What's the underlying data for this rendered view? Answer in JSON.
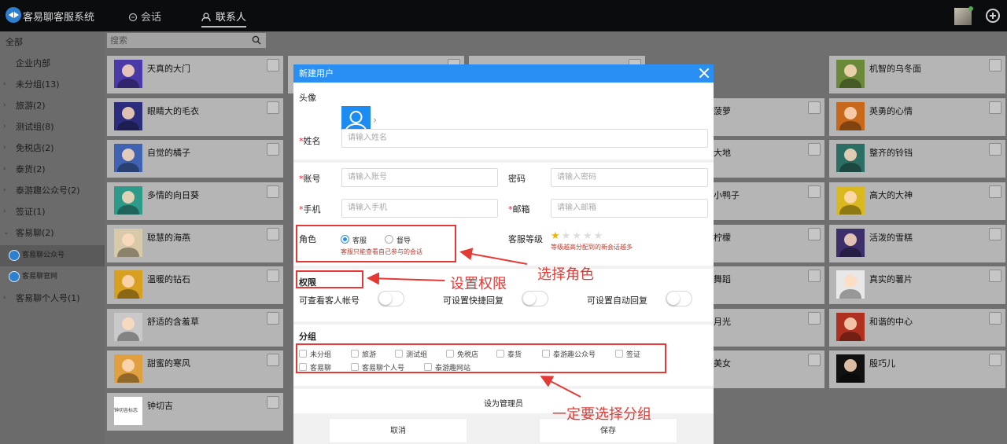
{
  "app": {
    "title": "客易聊客服系统"
  },
  "nav": {
    "conversations": "会话",
    "contacts": "联系人"
  },
  "sidebar": {
    "items": [
      {
        "label": "全部"
      },
      {
        "label": "企业内部"
      },
      {
        "label": "未分组(13)"
      },
      {
        "label": "旅游(2)"
      },
      {
        "label": "测试组(8)"
      },
      {
        "label": "免税店(2)"
      },
      {
        "label": "泰货(2)"
      },
      {
        "label": "泰游趣公众号(2)"
      },
      {
        "label": "签证(1)"
      },
      {
        "label": "客易聊(2)"
      },
      {
        "label": "客易聊公众号"
      },
      {
        "label": "客易聊官网"
      },
      {
        "label": "客易聊个人号(1)"
      }
    ]
  },
  "search": {
    "placeholder": "搜索"
  },
  "contacts": {
    "col1": [
      "天真的大门",
      "眼睛大的毛衣",
      "自觉的橘子",
      "多情的向日葵",
      "聪慧的海燕",
      "温暖的钻石",
      "舒适的含羞草",
      "甜蜜的寒风",
      "钟切吉"
    ],
    "col1_colors": [
      "#4a3aa8",
      "#2b2d7c",
      "#3f63b0",
      "#2e9a8a",
      "#d8c9a8",
      "#d7a020",
      "#c9c9c9",
      "#e0a040",
      "#ffffff"
    ],
    "col1_thumb_text": "钟切吉标志",
    "col4_partial": [
      "菠萝",
      "大地",
      "小鸭子",
      "柠檬",
      "舞蹈",
      "月光",
      "美女"
    ],
    "col5": [
      "机智的乌冬面",
      "英勇的心情",
      "整齐的铃铛",
      "高大的大神",
      "活泼的雪糕",
      "真实的薯片",
      "和谐的中心",
      "殷巧儿"
    ],
    "col5_colors": [
      "#6a8a3a",
      "#c7681a",
      "#2b6f64",
      "#d9b820",
      "#3d2f6a",
      "#e8e8e8",
      "#b03020",
      "#111111"
    ]
  },
  "modal": {
    "title": "新建用户",
    "avatar_label": "头像",
    "name": {
      "label": "姓名",
      "placeholder": "请输入姓名"
    },
    "account": {
      "label": "账号",
      "placeholder": "请输入账号"
    },
    "password": {
      "label": "密码",
      "placeholder": "请输入密码"
    },
    "phone": {
      "label": "手机",
      "placeholder": "请输入手机"
    },
    "email": {
      "label": "邮箱",
      "placeholder": "请输入邮箱"
    },
    "role": {
      "label": "角色",
      "option_agent": "客服",
      "option_supervisor": "督导",
      "selected": "客服",
      "hint": "客服只能查看自己参与的会话"
    },
    "level": {
      "label": "客服等级",
      "stars_total": 5,
      "stars_filled": 1,
      "hint": "等级越高分配到的新会话越多"
    },
    "permissions": {
      "title": "权限",
      "view_guest_account": "可查看客人帐号",
      "set_quick_reply": "可设置快捷回复",
      "set_auto_reply": "可设置自动回复"
    },
    "groups": {
      "title": "分组",
      "row1": [
        "未分组",
        "旅游",
        "测试组",
        "免税店",
        "泰货",
        "泰游趣公众号",
        "签证"
      ],
      "row2": [
        "客易聊",
        "客易聊个人号",
        "泰游趣网站"
      ]
    },
    "set_admin": "设为管理员",
    "cancel": "取消",
    "save": "保存"
  },
  "annotations": {
    "select_role": "选择角色",
    "set_permissions": "设置权限",
    "must_select_group": "一定要选择分组",
    "color": "#e53935"
  }
}
